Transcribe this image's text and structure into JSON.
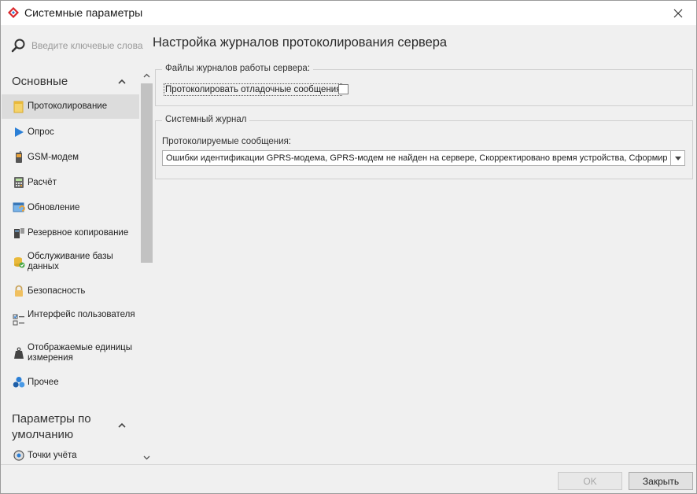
{
  "window": {
    "title": "Системные параметры"
  },
  "sidebar": {
    "search_placeholder": "Введите ключевые слова",
    "groups": [
      {
        "label": "Основные",
        "items": [
          {
            "label": "Протоколирование",
            "icon": "note-icon",
            "active": true
          },
          {
            "label": "Опрос",
            "icon": "play-icon"
          },
          {
            "label": "GSM-модем",
            "icon": "modem-icon"
          },
          {
            "label": "Расчёт",
            "icon": "calculator-icon"
          },
          {
            "label": "Обновление",
            "icon": "update-icon"
          },
          {
            "label": "Резервное копирование",
            "icon": "backup-icon"
          },
          {
            "label": "Обслуживание базы данных",
            "icon": "database-icon"
          },
          {
            "label": "Безопасность",
            "icon": "lock-icon"
          },
          {
            "label": "Интерфейс пользователя",
            "icon": "checklist-icon"
          },
          {
            "label": "Отображаемые единицы измерения",
            "icon": "weight-icon"
          },
          {
            "label": "Прочее",
            "icon": "cubes-icon"
          }
        ]
      },
      {
        "label": "Параметры по умолчанию",
        "items": [
          {
            "label": "Точки учёта",
            "icon": "meter-icon"
          }
        ]
      }
    ]
  },
  "main": {
    "title": "Настройка журналов протоколирования сервера",
    "server_logs": {
      "legend": "Файлы журналов работы сервера:",
      "debug_checkbox_label": "Протоколировать отладочные сообщения",
      "debug_checked": false
    },
    "system_log": {
      "legend": "Системный журнал",
      "messages_label": "Протоколируемые сообщения:",
      "messages_value": "Ошибки идентификации GPRS-модема, GPRS-модем не найден на сервере, Скорректировано время устройства, Сформиро..."
    }
  },
  "footer": {
    "ok_label": "OK",
    "close_label": "Закрыть"
  },
  "colors": {
    "accent_red": "#d9262b",
    "accent_blue": "#2b7fd6",
    "active_item_bg": "#dcdcdc"
  }
}
